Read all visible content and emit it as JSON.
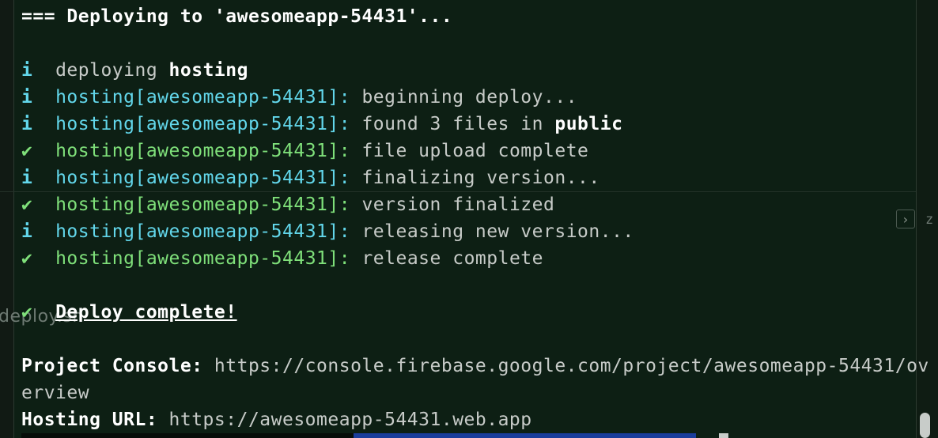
{
  "background": {
    "filename_fragment": "deploy.sh",
    "right_panel_char": "z"
  },
  "terminal": {
    "header": "=== Deploying to 'awesomeapp-54431'...",
    "lines": [
      {
        "marker": "i",
        "prefix": "deploying ",
        "target": "hosting",
        "text": ""
      },
      {
        "marker": "i",
        "prefix": "hosting[awesomeapp-54431]:",
        "text": " beginning deploy..."
      },
      {
        "marker": "i",
        "prefix": "hosting[awesomeapp-54431]:",
        "text": " found 3 files in ",
        "emph": "public"
      },
      {
        "marker": "✔",
        "prefix": "hosting[awesomeapp-54431]:",
        "text": " file upload complete"
      },
      {
        "marker": "i",
        "prefix": "hosting[awesomeapp-54431]:",
        "text": " finalizing version..."
      },
      {
        "marker": "✔",
        "prefix": "hosting[awesomeapp-54431]:",
        "text": " version finalized"
      },
      {
        "marker": "i",
        "prefix": "hosting[awesomeapp-54431]:",
        "text": " releasing new version..."
      },
      {
        "marker": "✔",
        "prefix": "hosting[awesomeapp-54431]:",
        "text": " release complete"
      }
    ],
    "complete_marker": "✔",
    "complete_text": "Deploy complete!",
    "console_label": "Project Console:",
    "console_url_line1": " https://console.firebase.google.com/project/awesomeapp-54431/ov",
    "console_url_line2": "erview",
    "hosting_label": "Hosting URL:",
    "hosting_url": " https://awesomeapp-54431.web.app"
  },
  "colors": {
    "background": "#0d1f14",
    "info": "#62d6ea",
    "success": "#7fe07a",
    "text": "#c7cbc8",
    "bold": "#ffffff"
  }
}
